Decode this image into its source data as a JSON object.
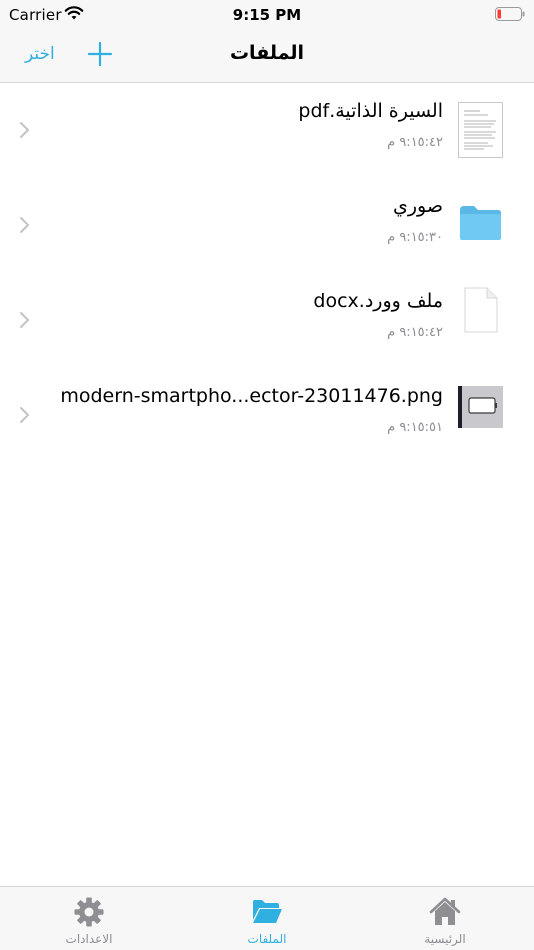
{
  "status_bar": {
    "carrier": "Carrier",
    "time": "9:15 PM"
  },
  "nav": {
    "title": "الملفات",
    "select_label": "اختر",
    "add_icon": "plus-icon"
  },
  "files": [
    {
      "name": "السيرة الذاتية.pdf",
      "time": "٩:١٥:٤٢ م",
      "icon": "pdf-thumbnail"
    },
    {
      "name": "صوري",
      "time": "٩:١٥:٣٠ م",
      "icon": "folder-icon"
    },
    {
      "name": "ملف وورد.docx",
      "time": "٩:١٥:٤٢ م",
      "icon": "document-icon"
    },
    {
      "name": "modern-smartpho...ector-23011476.png",
      "time": "٩:١٥:٥١ م",
      "icon": "image-thumbnail"
    }
  ],
  "tabs": [
    {
      "label": "الاعدادات",
      "icon": "gear-icon"
    },
    {
      "label": "الملفات",
      "icon": "folder-open-icon",
      "active": true
    },
    {
      "label": "الرئيسية",
      "icon": "home-icon"
    }
  ],
  "colors": {
    "accent": "#30b0e0",
    "folder": "#5ec4f0",
    "secondary_text": "#8e8e93"
  }
}
